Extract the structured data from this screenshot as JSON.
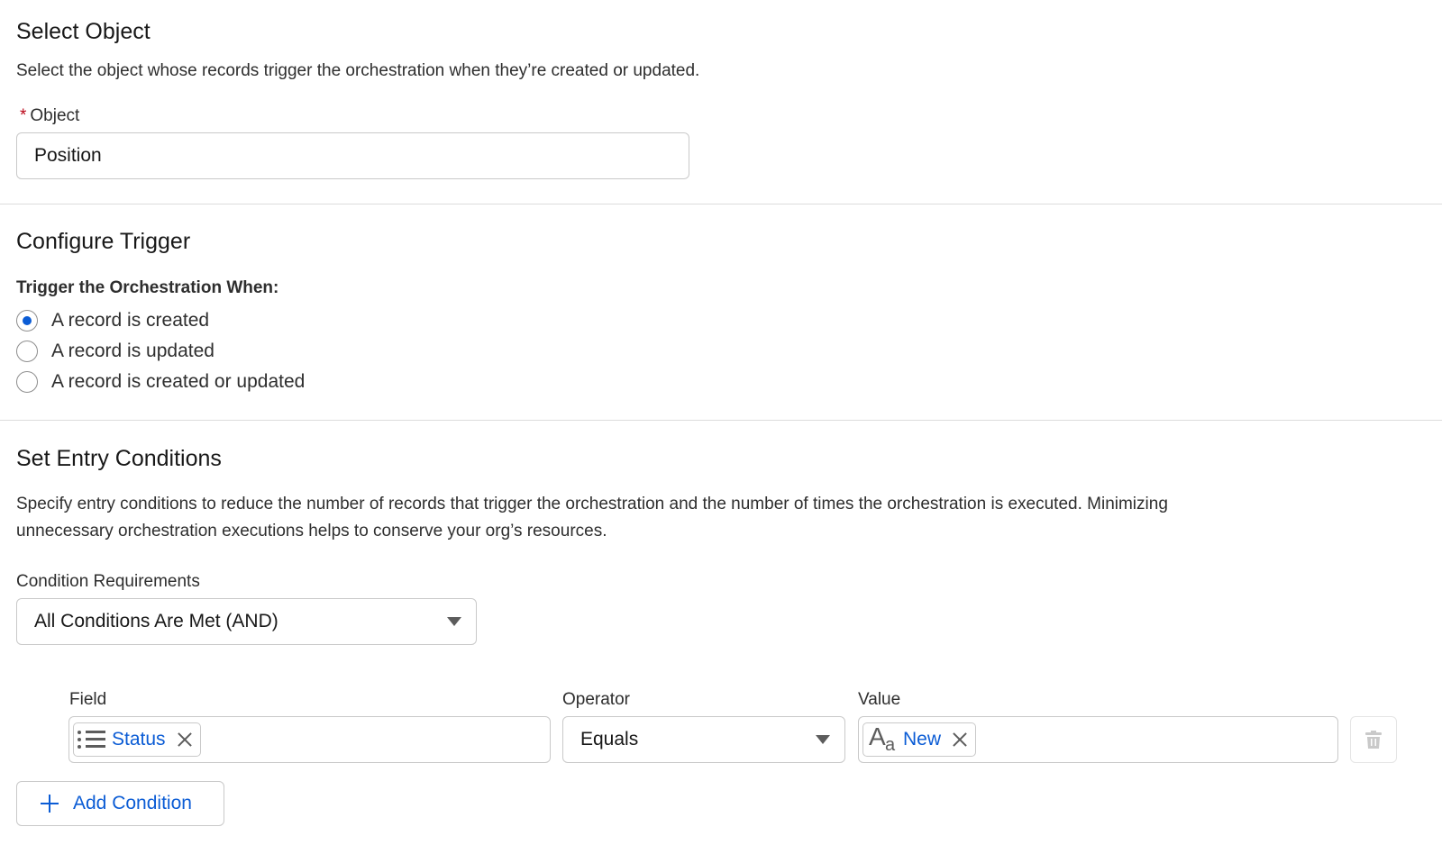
{
  "select_object": {
    "title": "Select Object",
    "description": "Select the object whose records trigger the orchestration when they’re created or updated.",
    "required_mark": "*",
    "object_label": "Object",
    "object_value": "Position"
  },
  "configure_trigger": {
    "title": "Configure Trigger",
    "heading": "Trigger the Orchestration When:",
    "options": [
      {
        "label": "A record is created",
        "selected": true
      },
      {
        "label": "A record is updated",
        "selected": false
      },
      {
        "label": "A record is created or updated",
        "selected": false
      }
    ]
  },
  "entry_conditions": {
    "title": "Set Entry Conditions",
    "description_line1": "Specify entry conditions to reduce the number of records that trigger the orchestration and the number of times the orchestration is executed. Minimizing",
    "description_line2": "unnecessary orchestration executions helps to conserve your org’s resources.",
    "requirements_label": "Condition Requirements",
    "requirements_value": "All Conditions Are Met (AND)",
    "condition": {
      "field_label": "Field",
      "field_value": "Status",
      "field_icon": "picklist-icon",
      "operator_label": "Operator",
      "operator_value": "Equals",
      "value_label": "Value",
      "value_value": "New",
      "value_icon": "text-type-icon",
      "value_icon_big": "A",
      "value_icon_small": "a"
    },
    "add_condition_label": "Add Condition"
  },
  "colors": {
    "accent": "#0b5cd5",
    "required": "#ba0517",
    "border": "#c9c9c9"
  }
}
